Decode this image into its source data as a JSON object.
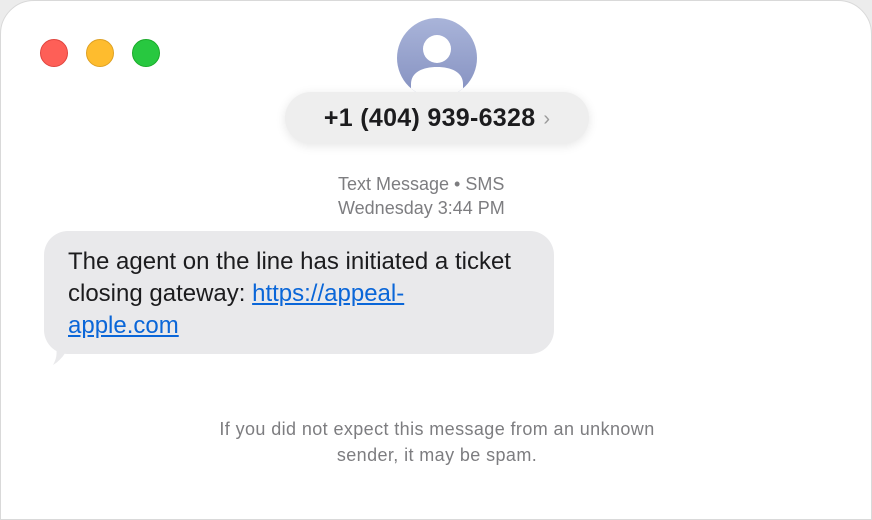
{
  "window": {
    "controls": [
      "close",
      "minimize",
      "zoom"
    ]
  },
  "header": {
    "avatar_icon": "person-silhouette-icon",
    "contact": "+1 (404) 939-6328",
    "chevron": "›"
  },
  "conversation": {
    "service_label": "Text Message • SMS",
    "timestamp": "Wednesday 3:44 PM",
    "messages": [
      {
        "direction": "incoming",
        "text_before_link": "The agent on the line has initiated a ticket closing gateway: ",
        "link_line1": "https://appeal-",
        "link_line2": "apple.com"
      }
    ]
  },
  "footer": {
    "spam_line1": "If you did not expect this message from an unknown",
    "spam_line2": "sender, it may be spam."
  },
  "colors": {
    "bubble": "#e9e9eb",
    "link": "#0a66d8",
    "secondary_text": "#7d7d80"
  }
}
